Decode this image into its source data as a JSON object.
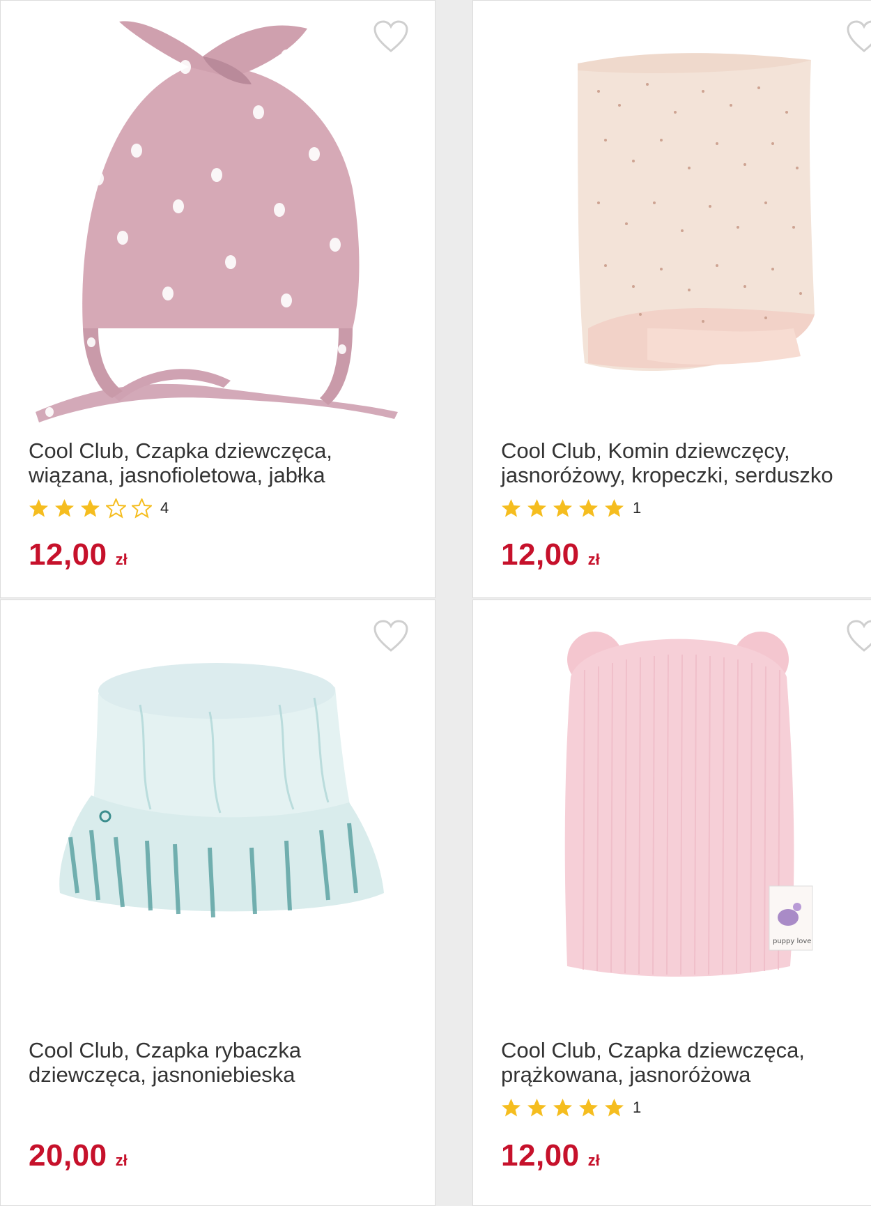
{
  "colors": {
    "price": "#c6112b",
    "star": "#f5bd1f",
    "heart": "#cfcfcf",
    "background": "#ececec"
  },
  "products": [
    {
      "title": "Cool Club, Czapka dziewczęca, wiązana, jasnofioletowa, jabłka",
      "title_line1": "Cool Club, Czapka dziewczęca,",
      "title_line2": "wiązana, jasnofioletowa, jabłka",
      "rating": 3,
      "rating_count": "4",
      "price": "12,00",
      "currency": "zł",
      "image": "pink tie beanie with apple print",
      "wishlist_icon": "heart-outline-icon"
    },
    {
      "title": "Cool Club, Komin dziewczęcy, jasnoróżowy, kropeczki, serduszko",
      "title_line1": "Cool Club, Komin dziewczęcy,",
      "title_line2": "jasnoróżowy, kropeczki, serduszko",
      "rating": 5,
      "rating_count": "1",
      "price": "12,00",
      "currency": "zł",
      "image": "light pink dotted neck warmer",
      "wishlist_icon": "heart-outline-icon"
    },
    {
      "title": "Cool Club, Czapka rybaczka dziewczęca, jasnoniebieska",
      "title_line1": "Cool Club, Czapka rybaczka",
      "title_line2": "dziewczęca, jasnoniebieska",
      "rating": null,
      "rating_count": null,
      "price": "20,00",
      "currency": "zł",
      "image": "light blue tie-dye bucket hat",
      "wishlist_icon": "heart-outline-icon"
    },
    {
      "title": "Cool Club, Czapka dziewczęca, prążkowana, jasnoróżowa",
      "title_line1": "Cool Club, Czapka dziewczęca,",
      "title_line2": "prążkowana, jasnoróżowa",
      "rating": 5,
      "rating_count": "1",
      "price": "12,00",
      "currency": "zł",
      "image": "pink ribbed beanie with ears",
      "wishlist_icon": "heart-outline-icon"
    }
  ]
}
